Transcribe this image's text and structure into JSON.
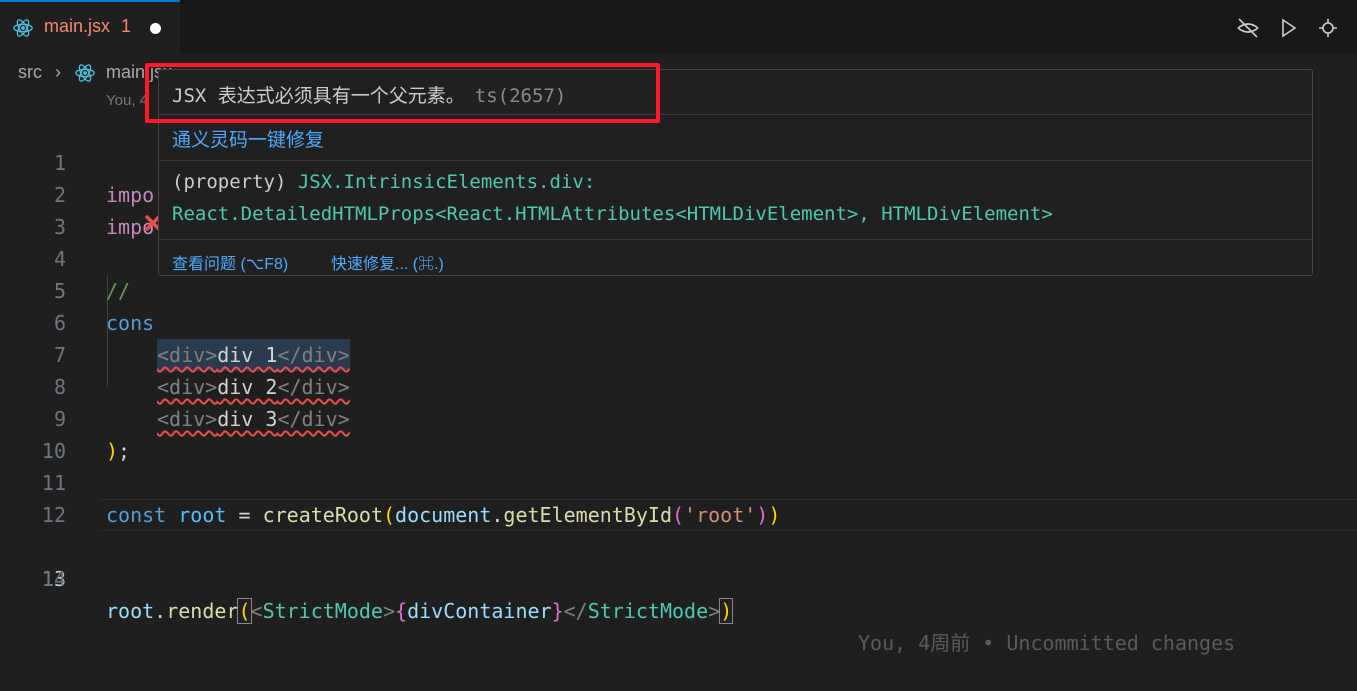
{
  "tab": {
    "icon": "react-icon",
    "label": "main.jsx",
    "problem_count": "1"
  },
  "toolbar": {
    "icons": [
      "eye-closed-icon",
      "run-icon",
      "compare-changes-icon"
    ]
  },
  "breadcrumb": {
    "folder": "src",
    "file": "main.jsx",
    "blame": "You, 4"
  },
  "hover": {
    "message": "JSX 表达式必须具有一个父元素。",
    "code": "ts(2657)",
    "fix_action": "通义灵码一键修复",
    "signature_line1_prefix": "(property) ",
    "signature_line1_type": "JSX.IntrinsicElements.div:",
    "signature_line2": "React.DetailedHTMLProps<React.HTMLAttributes<HTMLDivElement>, HTMLDivElement>",
    "view_problem": "查看问题 (⌥F8)",
    "quick_fix": "快速修复... (⌘.)"
  },
  "editor": {
    "line_numbers": [
      "1",
      "2",
      "3",
      "4",
      "5",
      "6",
      "7",
      "8",
      "9",
      "10",
      "11",
      "12",
      "13",
      "14"
    ],
    "active_line": "13",
    "l1": "impo",
    "l2": "impo",
    "l4": "//",
    "l5": "cons",
    "l6": {
      "open": "<div>",
      "text": "div 1",
      "close": "</div>"
    },
    "l7": {
      "open": "<div>",
      "text": "div 2",
      "close": "</div>"
    },
    "l8": {
      "open": "<div>",
      "text": "div 3",
      "close": "</div>"
    },
    "l9": {
      "paren": ")",
      "semi": ";"
    },
    "l11": {
      "kw": "const",
      "name": "root",
      "eq": "=",
      "fn": "createRoot",
      "p1": "(",
      "obj": "document",
      "dot": ".",
      "method": "getElementById",
      "p2": "(",
      "str": "'root'",
      "p3": ")",
      "p4": ")"
    },
    "l13": {
      "obj": "root",
      "dot": ".",
      "method": "render",
      "p1": "(",
      "lt": "<",
      "tag": "StrictMode",
      "gt": ">",
      "b1": "{",
      "var": "divContainer",
      "b2": "}",
      "close_lt": "</",
      "close_tag": "StrictMode",
      "close_gt": ">",
      "p2": ")"
    },
    "lens": "You, 4周前 • Uncommitted changes"
  },
  "colors": {
    "error_outline": "#ff1a2a",
    "tab_label": "#f48771",
    "link": "#4daafc"
  }
}
